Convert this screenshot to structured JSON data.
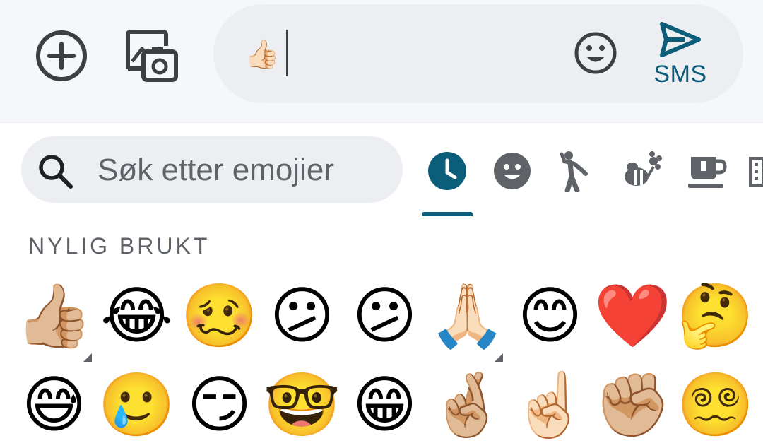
{
  "composer": {
    "attach_icon": "add-circle-icon",
    "media_icon": "gallery-camera-icon",
    "draft_text": "👍🏻",
    "emoji_icon": "smiley-icon",
    "send_label": "SMS",
    "send_icon": "send-icon"
  },
  "emoji_panel": {
    "search": {
      "placeholder": "Søk etter emojier",
      "icon": "search-icon"
    },
    "categories": [
      {
        "name": "recent",
        "icon": "clock-icon",
        "active": true
      },
      {
        "name": "smileys",
        "icon": "smiley-icon",
        "active": false
      },
      {
        "name": "people",
        "icon": "person-icon",
        "active": false
      },
      {
        "name": "animals",
        "icon": "bee-flower-icon",
        "active": false
      },
      {
        "name": "food",
        "icon": "cup-icon",
        "active": false
      },
      {
        "name": "travel",
        "icon": "building-icon",
        "active": false
      }
    ],
    "section_title": "NYLIG BRUKT",
    "rows": [
      [
        "👍🏼",
        "😂",
        "🥴",
        "😕",
        "😕",
        "🙏🏻",
        "😊",
        "❤️",
        "🤔"
      ],
      [
        "😅",
        "🥲",
        "😏",
        "🤓",
        "😁",
        "🤞🏼",
        "☝🏻",
        "✊🏼",
        "😵‍💫"
      ]
    ]
  },
  "colors": {
    "accent": "#0b5d7a",
    "icon_dark": "#3c4043",
    "icon_grey": "#5f6368",
    "surface": "#eceef1"
  }
}
